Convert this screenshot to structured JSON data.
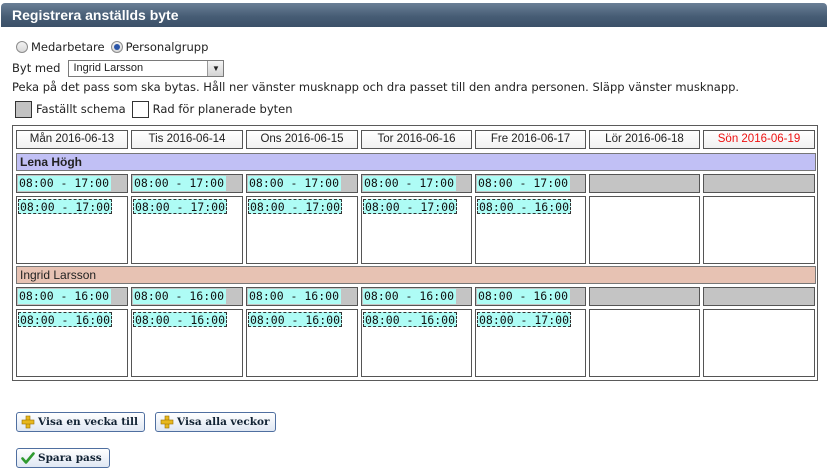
{
  "window": {
    "title": "Registrera anställds byte"
  },
  "mode": {
    "options": [
      {
        "label": "Medarbetare",
        "checked": false
      },
      {
        "label": "Personalgrupp",
        "checked": true
      }
    ]
  },
  "swap_with": {
    "label": "Byt med",
    "value": "Ingrid Larsson"
  },
  "instructions": "Peka på det pass som ska bytas. Håll ner vänster musknapp och dra passet till den andra personen. Släpp vänster musknapp.",
  "legend": {
    "fixed": "Faställt schema",
    "planned": "Rad för planerade byten"
  },
  "days": [
    "Mån 2016-06-13",
    "Tis 2016-06-14",
    "Ons 2016-06-15",
    "Tor 2016-06-16",
    "Fre 2016-06-17",
    "Lör 2016-06-18",
    "Sön 2016-06-19"
  ],
  "persons": [
    {
      "name": "Lena Högh",
      "fixed": [
        "08:00 - 17:00",
        "08:00 - 17:00",
        "08:00 - 17:00",
        "08:00 - 17:00",
        "08:00 - 17:00",
        "",
        ""
      ],
      "planned": [
        "08:00 - 17:00",
        "08:00 - 17:00",
        "08:00 - 17:00",
        "08:00 - 17:00",
        "08:00 - 16:00",
        "",
        ""
      ]
    },
    {
      "name": "Ingrid Larsson",
      "fixed": [
        "08:00 - 16:00",
        "08:00 - 16:00",
        "08:00 - 16:00",
        "08:00 - 16:00",
        "08:00 - 16:00",
        "",
        ""
      ],
      "planned": [
        "08:00 - 16:00",
        "08:00 - 16:00",
        "08:00 - 16:00",
        "08:00 - 16:00",
        "08:00 - 17:00",
        "",
        ""
      ]
    }
  ],
  "buttons": {
    "next_week": "Visa en vecka till",
    "all_weeks": "Visa alla veckor",
    "save": "Spara pass"
  },
  "colors": {
    "shift_bg": "#aefcf5",
    "person1_bg": "#c1c0f5",
    "person2_bg": "#e7c2b3",
    "sunday": "#ee1111"
  }
}
